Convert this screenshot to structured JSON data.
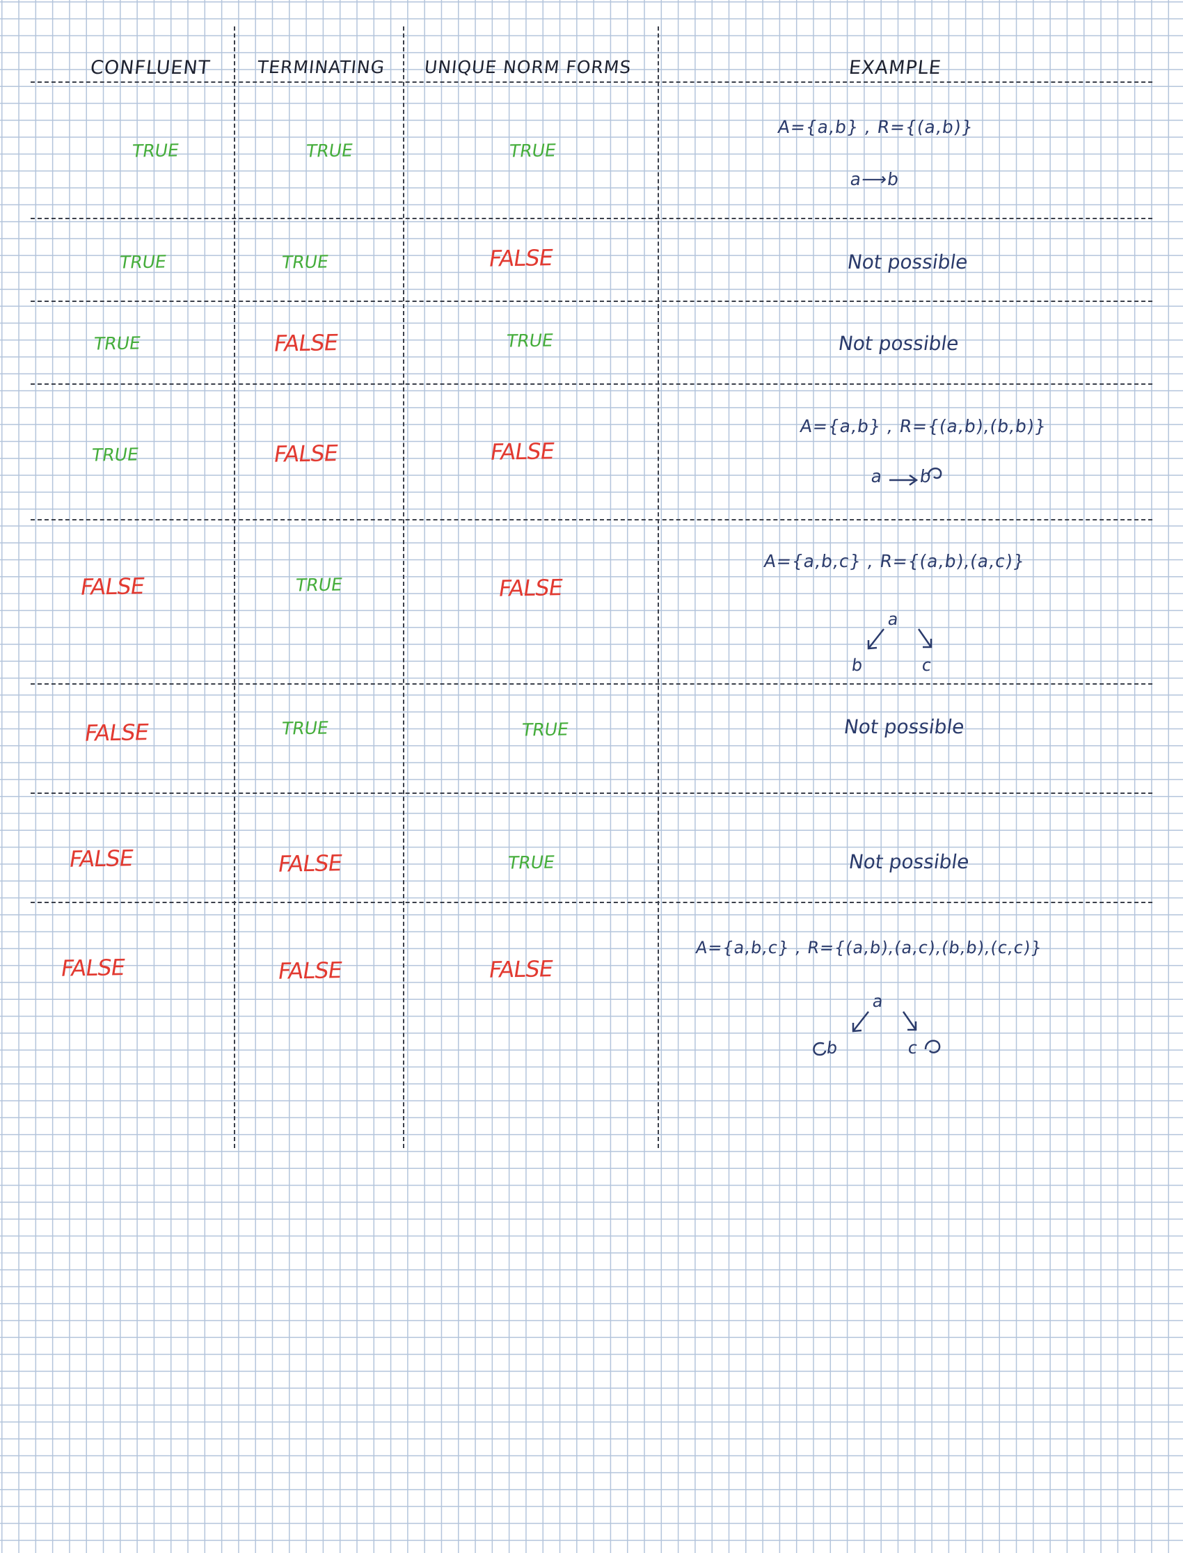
{
  "headers": {
    "confluent": "CONFLUENT",
    "terminating": "TERMINATING",
    "unique_normal_forms": "UNIQUE NORM FORMS",
    "example": "EXAMPLE"
  },
  "rows": [
    {
      "confluent": "TRUE",
      "terminating": "TRUE",
      "unique": "TRUE",
      "example": {
        "line1": "A={a,b} , R={(a,b)}",
        "diagram": "a⟶b"
      }
    },
    {
      "confluent": "TRUE",
      "terminating": "TRUE",
      "unique": "FALSE",
      "example": {
        "note": "Not possible"
      }
    },
    {
      "confluent": "TRUE",
      "terminating": "FALSE",
      "unique": "TRUE",
      "example": {
        "note": "Not possible"
      }
    },
    {
      "confluent": "TRUE",
      "terminating": "FALSE",
      "unique": "FALSE",
      "example": {
        "line1": "A={a,b} , R={(a,b),(b,b)}",
        "node_a": "a",
        "node_b": "b"
      }
    },
    {
      "confluent": "FALSE",
      "terminating": "TRUE",
      "unique": "FALSE",
      "example": {
        "line1": "A={a,b,c} , R={(a,b),(a,c)}",
        "node_a": "a",
        "node_b": "b",
        "node_c": "c"
      }
    },
    {
      "confluent": "FALSE",
      "terminating": "TRUE",
      "unique": "TRUE",
      "example": {
        "note": "Not possible"
      }
    },
    {
      "confluent": "FALSE",
      "terminating": "FALSE",
      "unique": "TRUE",
      "example": {
        "note": "Not possible"
      }
    },
    {
      "confluent": "FALSE",
      "terminating": "FALSE",
      "unique": "FALSE",
      "example": {
        "line1": "A={a,b,c} , R={(a,b),(a,c),(b,b),(c,c)}",
        "node_a": "a",
        "node_b": "b",
        "node_c": "c"
      }
    }
  ],
  "colors": {
    "true_text": "#45ad3b",
    "false_text": "#e23a31",
    "example_ink": "#2b3b6b",
    "grid": "#b3c4db",
    "rule_lines": "#3a3f4a"
  }
}
